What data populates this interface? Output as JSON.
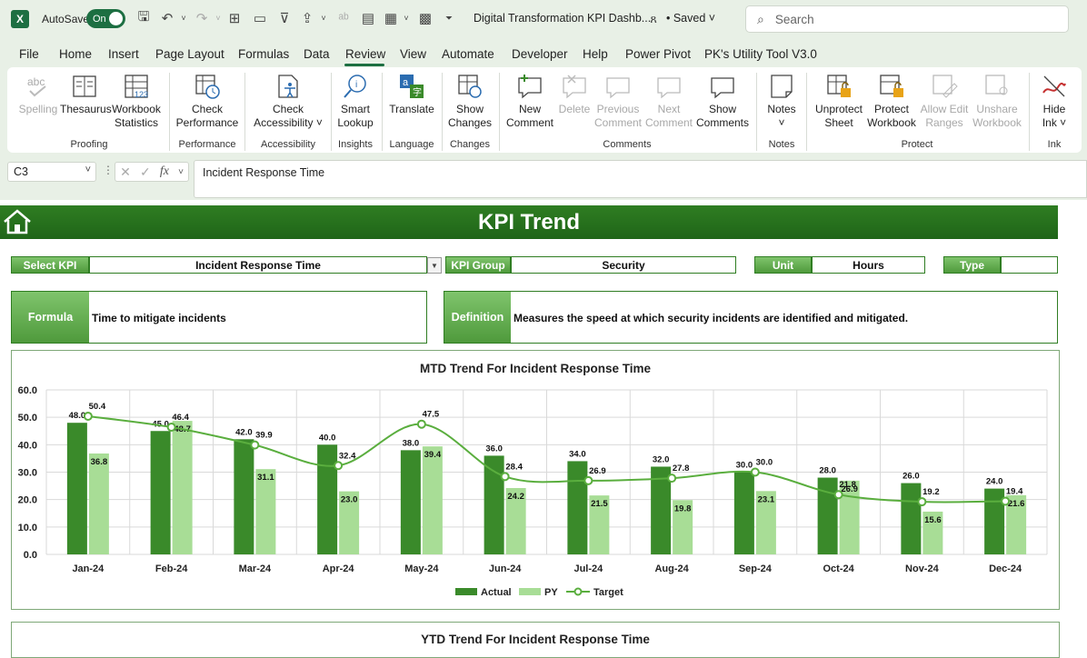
{
  "app": {
    "autosave_label": "AutoSave",
    "autosave_state": "On",
    "doc_title": "Digital Transformation KPI Dashb...",
    "saved_label": "• Saved",
    "search_placeholder": "Search"
  },
  "menu": [
    "File",
    "Home",
    "Insert",
    "Page Layout",
    "Formulas",
    "Data",
    "Review",
    "View",
    "Automate",
    "Developer",
    "Help",
    "Power Pivot",
    "PK's Utility Tool V3.0"
  ],
  "ribbon": {
    "buttons": {
      "spelling": "Spelling",
      "thesaurus": "Thesaurus",
      "workbook_stats_1": "Workbook",
      "workbook_stats_2": "Statistics",
      "check_perf_1": "Check",
      "check_perf_2": "Performance",
      "check_acc_1": "Check",
      "check_acc_2": "Accessibility ˅",
      "smart_1": "Smart",
      "smart_2": "Lookup",
      "translate": "Translate",
      "show_changes_1": "Show",
      "show_changes_2": "Changes",
      "new_comment_1": "New",
      "new_comment_2": "Comment",
      "delete": "Delete",
      "prev_1": "Previous",
      "prev_2": "Comment",
      "next_1": "Next",
      "next_2": "Comment",
      "show_comments_1": "Show",
      "show_comments_2": "Comments",
      "notes": "Notes",
      "unprotect_1": "Unprotect",
      "unprotect_2": "Sheet",
      "protect_wb_1": "Protect",
      "protect_wb_2": "Workbook",
      "allow_edit_1": "Allow Edit",
      "allow_edit_2": "Ranges",
      "unshare_1": "Unshare",
      "unshare_2": "Workbook",
      "hide_ink_1": "Hide",
      "hide_ink_2": "Ink ˅"
    },
    "groups": [
      "Proofing",
      "Performance",
      "Accessibility",
      "Insights",
      "Language",
      "Changes",
      "Comments",
      "Notes",
      "Protect",
      "Ink"
    ]
  },
  "formula_bar": {
    "cell_ref": "C3",
    "content": "Incident Response Time"
  },
  "dashboard": {
    "title": "KPI Trend",
    "select_kpi_label": "Select KPI",
    "select_kpi_value": "Incident Response Time",
    "kpi_group_label": "KPI Group",
    "kpi_group_value": "Security",
    "unit_label": "Unit",
    "unit_value": "Hours",
    "type_label": "Type",
    "type_value": "",
    "formula_label": "Formula",
    "formula_value": "Time to mitigate incidents",
    "definition_label": "Definition",
    "definition_value": "Measures the speed at which security incidents are identified and mitigated."
  },
  "colors": {
    "actual": "#3a8a2a",
    "py": "#a8dd96",
    "target": "#5aae3e",
    "banner": "#2a7420"
  },
  "chart_data": [
    {
      "type": "bar",
      "title": "MTD Trend For Incident Response Time",
      "categories": [
        "Jan-24",
        "Feb-24",
        "Mar-24",
        "Apr-24",
        "May-24",
        "Jun-24",
        "Jul-24",
        "Aug-24",
        "Sep-24",
        "Oct-24",
        "Nov-24",
        "Dec-24"
      ],
      "series": [
        {
          "name": "Actual",
          "kind": "bar",
          "values": [
            48.0,
            45.0,
            42.0,
            40.0,
            38.0,
            36.0,
            34.0,
            32.0,
            30.0,
            28.0,
            26.0,
            24.0
          ]
        },
        {
          "name": "PY",
          "kind": "bar",
          "values": [
            36.8,
            48.7,
            31.1,
            23.0,
            39.4,
            24.2,
            21.5,
            19.8,
            23.1,
            26.9,
            15.6,
            21.6
          ]
        },
        {
          "name": "Target",
          "kind": "line",
          "values": [
            50.4,
            46.4,
            39.9,
            32.4,
            47.5,
            28.4,
            26.9,
            27.8,
            30.0,
            21.8,
            19.2,
            19.4
          ]
        }
      ],
      "yticks": [
        "0.0",
        "10.0",
        "20.0",
        "30.0",
        "40.0",
        "50.0",
        "60.0"
      ],
      "ylim": [
        0,
        60
      ],
      "grid": true,
      "legend": "bottom"
    },
    {
      "type": "bar",
      "title": "YTD Trend For Incident Response Time"
    }
  ]
}
